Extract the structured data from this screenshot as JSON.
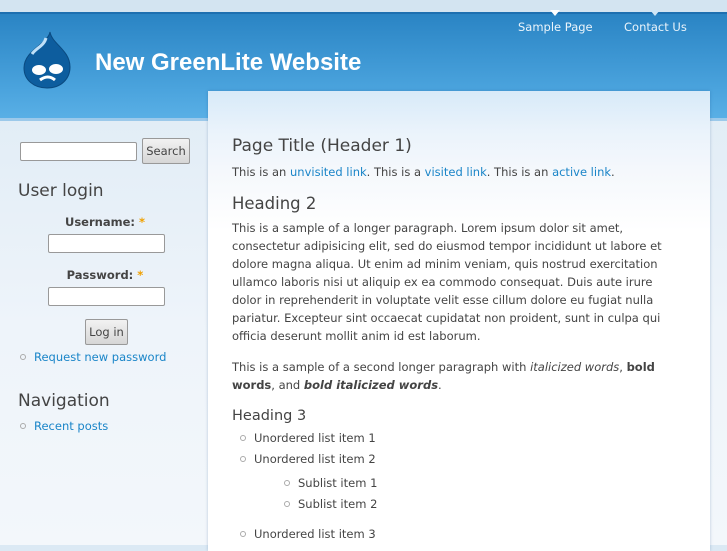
{
  "site": {
    "name": "New GreenLite Website"
  },
  "nav": [
    "Sample Page",
    "Contact Us"
  ],
  "sidebar": {
    "search_button": "Search",
    "login_title": "User login",
    "username_label": "Username:",
    "password_label": "Password:",
    "required": "*",
    "login_button": "Log in",
    "request_password": "Request new password",
    "navigation_title": "Navigation",
    "recent_posts": "Recent posts"
  },
  "content": {
    "title": "Page Title (Header 1)",
    "links_intro": [
      "This is an ",
      "unvisited link",
      ". This is a ",
      "visited link",
      ". This is an ",
      "active link",
      "."
    ],
    "h2": "Heading 2",
    "para1": "This is a sample of a longer paragraph. Lorem ipsum dolor sit amet, consectetur adipisicing elit, sed do eiusmod tempor incididunt ut labore et dolore magna aliqua. Ut enim ad minim veniam, quis nostrud exercitation ullamco laboris nisi ut aliquip ex ea commodo consequat. Duis aute irure dolor in reprehenderit in voluptate velit esse cillum dolore eu fugiat nulla pariatur. Excepteur sint occaecat cupidatat non proident, sunt in culpa qui officia deserunt mollit anim id est laborum.",
    "para2": [
      "This is a sample of a second longer paragraph with ",
      "italicized words",
      ", ",
      "bold words",
      ", and ",
      "bold italicized words",
      "."
    ],
    "h3": "Heading 3",
    "list": [
      "Unordered list item 1",
      "Unordered list item 2",
      "Unordered list item 3"
    ],
    "sublist": [
      "Sublist item 1",
      "Sublist item 2"
    ]
  }
}
